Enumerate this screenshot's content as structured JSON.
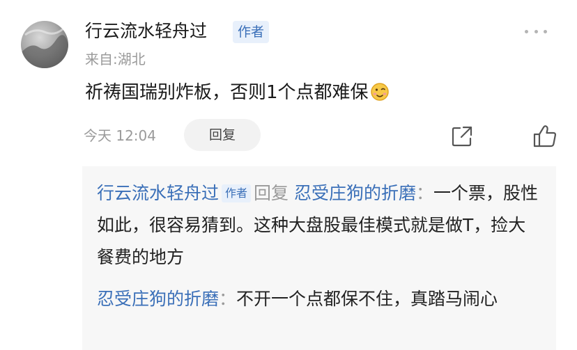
{
  "comment": {
    "username": "行云流水轻舟过",
    "author_badge": "作者",
    "location": "来自:湖北",
    "text": "祈祷国瑞别炸板，否则1个点都难保",
    "timestamp": "今天 12:04",
    "reply_label": "回复"
  },
  "replies": [
    {
      "from": "行云流水轻舟过",
      "badge": "作者",
      "reply_word": "回复",
      "to": "忍受庄狗的折磨",
      "colon": "：",
      "text": "一个票，股性如此，很容易猜到。这种大盘股最佳模式就是做T，捡大餐费的地方"
    },
    {
      "from": "忍受庄狗的折磨",
      "colon": "：",
      "text": "不开一个点都保不住，真踏马闹心"
    }
  ],
  "colors": {
    "link_blue": "#3a6fb8",
    "badge_bg": "#e8f0fb",
    "muted_gray": "#9a9a9a",
    "sub_box_bg": "#f7f7f7"
  },
  "icons": [
    "avatar-image",
    "more-icon",
    "emoji-icon",
    "share-icon",
    "like-icon"
  ]
}
